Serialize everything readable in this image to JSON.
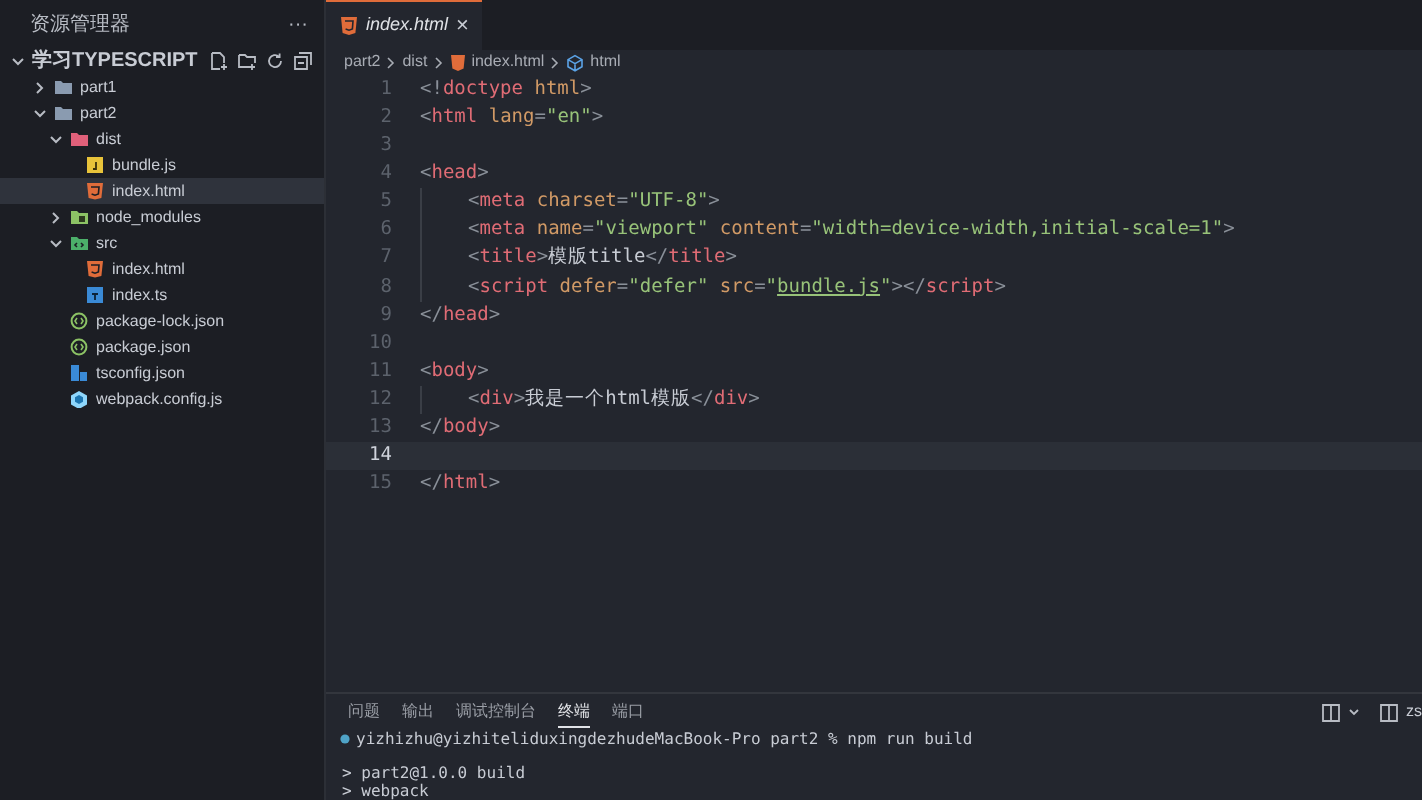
{
  "sidebar": {
    "title": "资源管理器",
    "more": "···",
    "root": {
      "label": "学习TYPESCRIPT",
      "expanded": true
    },
    "tree": [
      {
        "label": "part1",
        "kind": "folder",
        "expanded": false,
        "selected": false
      },
      {
        "label": "part2",
        "kind": "folder",
        "expanded": true,
        "selected": false,
        "children": [
          {
            "label": "dist",
            "kind": "folder-dist",
            "expanded": true,
            "selected": false,
            "children": [
              {
                "label": "bundle.js",
                "kind": "js",
                "selected": false
              },
              {
                "label": "index.html",
                "kind": "html",
                "selected": true
              }
            ]
          },
          {
            "label": "node_modules",
            "kind": "folder-node",
            "expanded": false,
            "selected": false
          },
          {
            "label": "src",
            "kind": "folder-src",
            "expanded": true,
            "selected": false,
            "children": [
              {
                "label": "index.html",
                "kind": "html",
                "selected": false
              },
              {
                "label": "index.ts",
                "kind": "ts",
                "selected": false
              }
            ]
          },
          {
            "label": "package-lock.json",
            "kind": "json",
            "selected": false
          },
          {
            "label": "package.json",
            "kind": "json",
            "selected": false
          },
          {
            "label": "tsconfig.json",
            "kind": "tsconfig",
            "selected": false
          },
          {
            "label": "webpack.config.js",
            "kind": "webpack",
            "selected": false
          }
        ]
      }
    ]
  },
  "tab": {
    "label": "index.html",
    "close": "×"
  },
  "breadcrumb": [
    "part2",
    "dist",
    "index.html",
    "html"
  ],
  "code": [
    {
      "number": "1",
      "current": false,
      "tokens": [
        {
          "kind": "punct",
          "text": "<!"
        },
        {
          "kind": "tag",
          "text": "doctype"
        },
        {
          "kind": "attr",
          "text": " html"
        },
        {
          "kind": "punct",
          "text": ">"
        }
      ]
    },
    {
      "number": "2",
      "current": false,
      "tokens": [
        {
          "kind": "punct",
          "text": "<"
        },
        {
          "kind": "tag",
          "text": "html"
        },
        {
          "kind": "attr",
          "text": " lang"
        },
        {
          "kind": "punct",
          "text": "="
        },
        {
          "kind": "string",
          "text": "\"en\""
        },
        {
          "kind": "punct",
          "text": ">"
        }
      ]
    },
    {
      "number": "3",
      "current": false
    },
    {
      "number": "4",
      "current": false,
      "tokens": [
        {
          "kind": "punct",
          "text": "<"
        },
        {
          "kind": "tag",
          "text": "head"
        },
        {
          "kind": "punct",
          "text": ">"
        }
      ]
    },
    {
      "number": "5",
      "current": false,
      "indented": true,
      "tokens": [
        {
          "kind": "punct",
          "text": "<"
        },
        {
          "kind": "tag",
          "text": "meta"
        },
        {
          "kind": "attr",
          "text": " charset"
        },
        {
          "kind": "punct",
          "text": "="
        },
        {
          "kind": "string",
          "text": "\"UTF-8\""
        },
        {
          "kind": "punct",
          "text": ">"
        }
      ]
    },
    {
      "number": "6",
      "current": false,
      "indented": true,
      "tokens": [
        {
          "kind": "punct",
          "text": "<"
        },
        {
          "kind": "tag",
          "text": "meta"
        },
        {
          "kind": "attr",
          "text": " name"
        },
        {
          "kind": "punct",
          "text": "="
        },
        {
          "kind": "string",
          "text": "\"viewport\""
        },
        {
          "kind": "attr",
          "text": " content"
        },
        {
          "kind": "punct",
          "text": "="
        },
        {
          "kind": "string",
          "text": "\"width=device-width,initial-scale=1\""
        },
        {
          "kind": "punct",
          "text": ">"
        }
      ]
    },
    {
      "number": "7",
      "current": false,
      "indented": true,
      "tokens": [
        {
          "kind": "punct",
          "text": "<"
        },
        {
          "kind": "tag",
          "text": "title"
        },
        {
          "kind": "punct",
          "text": ">"
        },
        {
          "kind": "text",
          "text": "模版title"
        },
        {
          "kind": "punct",
          "text": "</"
        },
        {
          "kind": "tag",
          "text": "title"
        },
        {
          "kind": "punct",
          "text": ">"
        }
      ]
    },
    {
      "number": "8",
      "current": false,
      "indented": true,
      "tokens": [
        {
          "kind": "punct",
          "text": "<"
        },
        {
          "kind": "tag",
          "text": "script"
        },
        {
          "kind": "attr",
          "text": " defer"
        },
        {
          "kind": "punct",
          "text": "="
        },
        {
          "kind": "string",
          "text": "\"defer\""
        },
        {
          "kind": "attr",
          "text": " src"
        },
        {
          "kind": "punct",
          "text": "="
        },
        {
          "kind": "string",
          "text": "\""
        },
        {
          "kind": "link",
          "text": "bundle.js"
        },
        {
          "kind": "string",
          "text": "\""
        },
        {
          "kind": "punct",
          "text": "></"
        },
        {
          "kind": "tag",
          "text": "script"
        },
        {
          "kind": "punct",
          "text": ">"
        }
      ]
    },
    {
      "number": "9",
      "current": false,
      "tokens": [
        {
          "kind": "punct",
          "text": "</"
        },
        {
          "kind": "tag",
          "text": "head"
        },
        {
          "kind": "punct",
          "text": ">"
        }
      ]
    },
    {
      "number": "10",
      "current": false
    },
    {
      "number": "11",
      "current": false,
      "tokens": [
        {
          "kind": "punct",
          "text": "<"
        },
        {
          "kind": "tag",
          "text": "body"
        },
        {
          "kind": "punct",
          "text": ">"
        }
      ]
    },
    {
      "number": "12",
      "current": false,
      "indented": true,
      "tokens": [
        {
          "kind": "punct",
          "text": "<"
        },
        {
          "kind": "tag",
          "text": "div"
        },
        {
          "kind": "punct",
          "text": ">"
        },
        {
          "kind": "text",
          "text": "我是一个html模版"
        },
        {
          "kind": "punct",
          "text": "</"
        },
        {
          "kind": "tag",
          "text": "div"
        },
        {
          "kind": "punct",
          "text": ">"
        }
      ]
    },
    {
      "number": "13",
      "current": false,
      "tokens": [
        {
          "kind": "punct",
          "text": "</"
        },
        {
          "kind": "tag",
          "text": "body"
        },
        {
          "kind": "punct",
          "text": ">"
        }
      ]
    },
    {
      "number": "14",
      "current": true
    },
    {
      "number": "15",
      "current": false,
      "tokens": [
        {
          "kind": "punct",
          "text": "</"
        },
        {
          "kind": "tag",
          "text": "html"
        },
        {
          "kind": "punct",
          "text": ">"
        }
      ]
    }
  ],
  "panel": {
    "tabs": [
      {
        "label": "问题",
        "selected": false
      },
      {
        "label": "输出",
        "selected": false
      },
      {
        "label": "调试控制台",
        "selected": false
      },
      {
        "label": "终端",
        "selected": true
      },
      {
        "label": "端口",
        "selected": false
      }
    ],
    "terminal_label": "zs",
    "terminal": [
      {
        "kind": "prompt",
        "text": "yizhizhu@yizhiteliduxingdezhudeMacBook-Pro part2 % npm run build"
      },
      {
        "kind": "output",
        "text": "> part2@1.0.0 build"
      },
      {
        "kind": "output",
        "text": "> webpack"
      }
    ]
  }
}
